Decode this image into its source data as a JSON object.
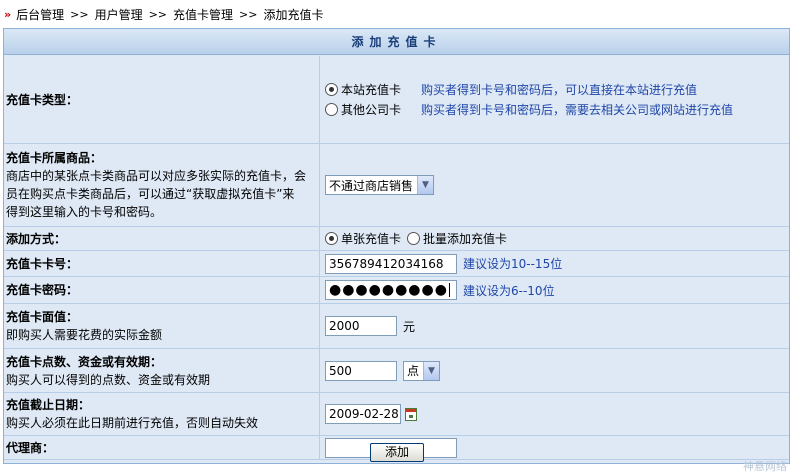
{
  "breadcrumb": {
    "arrow": "»",
    "items": [
      "后台管理",
      "用户管理",
      "充值卡管理",
      "添加充值卡"
    ],
    "separator": ">>"
  },
  "form": {
    "title": "添加充值卡",
    "card_type": {
      "label": "充值卡类型：",
      "options": [
        {
          "label": "本站充值卡",
          "hint": "购买者得到卡号和密码后，可以直接在本站进行充值",
          "selected": true
        },
        {
          "label": "其他公司卡",
          "hint": "购买者得到卡号和密码后，需要去相关公司或网站进行充值",
          "selected": false
        }
      ]
    },
    "product": {
      "label": "充值卡所属商品：",
      "description": [
        "商店中的某张点卡类商品可以对应多张实际的充值卡，会",
        "员在购买点卡类商品后，可以通过“获取虚拟充值卡”来",
        "得到这里输入的卡号和密码。"
      ],
      "selected": "不通过商店销售"
    },
    "add_method": {
      "label": "添加方式：",
      "options": [
        {
          "label": "单张充值卡",
          "selected": true
        },
        {
          "label": "批量添加充值卡",
          "selected": false
        }
      ]
    },
    "card_number": {
      "label": "充值卡卡号：",
      "value": "356789412034168",
      "hint": "建议设为10--15位"
    },
    "card_password": {
      "label": "充值卡密码：",
      "value": "●●●●●●●●●",
      "hint": "建议设为6--10位"
    },
    "face_value": {
      "label": "充值卡面值：",
      "description": "即购买人需要花费的实际金额",
      "value": "2000",
      "unit": "元"
    },
    "points": {
      "label": "充值卡点数、资金或有效期：",
      "description": "购买人可以得到的点数、资金或有效期",
      "value": "500",
      "unit_selected": "点"
    },
    "expiry": {
      "label": "充值截止日期：",
      "description": "购买人必须在此日期前进行充值，否则自动失效",
      "value": "2009-02-28"
    },
    "agent": {
      "label": "代理商：",
      "value": ""
    },
    "submit_label": "添加"
  },
  "watermark": "神悬网络",
  "icons": {
    "calendar": "calendar-icon",
    "dropdown": "chevron-down-icon"
  }
}
